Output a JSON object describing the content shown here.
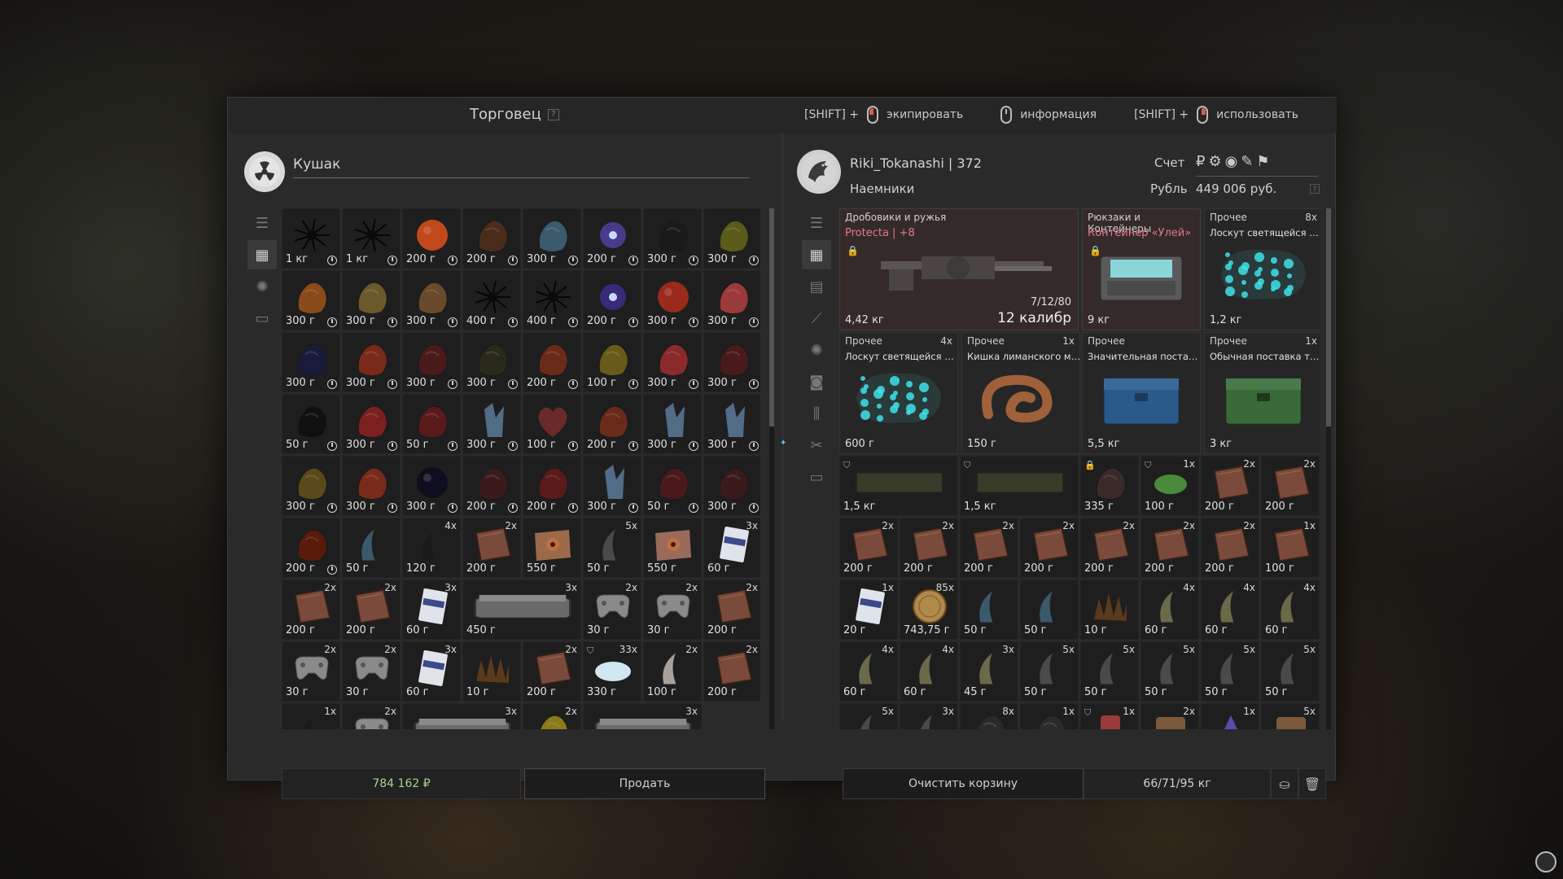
{
  "header": {
    "title": "Торговец",
    "help": "?",
    "hints": [
      {
        "prefix": "[SHIFT] +",
        "mouse": "left",
        "label": "экипировать"
      },
      {
        "prefix": "",
        "mouse": "middle",
        "label": "информация"
      },
      {
        "prefix": "[SHIFT] +",
        "mouse": "right",
        "label": "использовать"
      }
    ]
  },
  "trader": {
    "name": "Кушак",
    "icon": "radiation-icon",
    "money": "784 162 ₽",
    "sell_label": "Продать",
    "items": [
      {
        "price": "1 кг",
        "icon": "spiky-black-artifact",
        "clock": true,
        "color": "#101010"
      },
      {
        "price": "1 кг",
        "icon": "spiky-black-artifact",
        "clock": true,
        "color": "#121212"
      },
      {
        "price": "200 г",
        "icon": "fire-orb",
        "clock": true,
        "color": "#c0481a"
      },
      {
        "price": "200 г",
        "icon": "brown-crystal",
        "clock": true,
        "color": "#4b2b1a"
      },
      {
        "price": "300 г",
        "icon": "blue-mist",
        "clock": true,
        "color": "#3b5a6b"
      },
      {
        "price": "200 г",
        "icon": "blue-spark",
        "clock": true,
        "color": "#4a3a8a"
      },
      {
        "price": "300 г",
        "icon": "black-crystal",
        "clock": true,
        "color": "#1a1a1a"
      },
      {
        "price": "300 г",
        "icon": "yellow-black-rock",
        "clock": true,
        "color": "#5a5a1a"
      },
      {
        "price": "300 г",
        "icon": "amber-rock",
        "clock": true,
        "color": "#8a4a1a"
      },
      {
        "price": "300 г",
        "icon": "green-shard",
        "clock": true,
        "color": "#6a5a2a"
      },
      {
        "price": "300 г",
        "icon": "green-shard",
        "clock": true,
        "color": "#6a4a2a"
      },
      {
        "price": "400 г",
        "icon": "black-spike",
        "clock": true,
        "color": "#0e0e0e"
      },
      {
        "price": "400 г",
        "icon": "black-spike",
        "clock": true,
        "color": "#0e0e0e"
      },
      {
        "price": "200 г",
        "icon": "blue-spark",
        "clock": true,
        "color": "#3a2a7a"
      },
      {
        "price": "300 г",
        "icon": "red-orb",
        "clock": true,
        "color": "#9a2a1a"
      },
      {
        "price": "300 г",
        "icon": "red-crystal",
        "clock": true,
        "color": "#9a3a3a"
      },
      {
        "price": "300 г",
        "icon": "dark-rock",
        "clock": true,
        "color": "#1a1a3a"
      },
      {
        "price": "300 г",
        "icon": "red-rock",
        "clock": true,
        "color": "#7a2a1a"
      },
      {
        "price": "300 г",
        "icon": "dark-red-rock",
        "clock": true,
        "color": "#4a1a1a"
      },
      {
        "price": "300 г",
        "icon": "dark-green-shard",
        "clock": true,
        "color": "#2a2a1a"
      },
      {
        "price": "200 г",
        "icon": "lava-rock",
        "clock": true,
        "color": "#6a2a1a"
      },
      {
        "price": "100 г",
        "icon": "yellow-shard",
        "clock": true,
        "color": "#6a5a1a"
      },
      {
        "price": "300 г",
        "icon": "red-rock",
        "clock": true,
        "color": "#8a2a2a"
      },
      {
        "price": "300 г",
        "icon": "dark-red-rock",
        "clock": true,
        "color": "#4a1a1a"
      },
      {
        "price": "50 г",
        "icon": "black-leaf",
        "clock": true,
        "color": "#101010"
      },
      {
        "price": "300 г",
        "icon": "red-rock",
        "clock": true,
        "color": "#7a2020"
      },
      {
        "price": "50 г",
        "icon": "red-leaf",
        "clock": true,
        "color": "#5a1a1a"
      },
      {
        "price": "300 г",
        "icon": "blue-crystal",
        "clock": true,
        "color": "#5a7a9a"
      },
      {
        "price": "100 г",
        "icon": "heart",
        "clock": true,
        "color": "#6a2a2a"
      },
      {
        "price": "200 г",
        "icon": "lava-rock",
        "clock": true,
        "color": "#6a2a1a"
      },
      {
        "price": "300 г",
        "icon": "blue-crystal",
        "clock": true,
        "color": "#5a7a9a"
      },
      {
        "price": "300 г",
        "icon": "blue-crystal",
        "clock": true,
        "color": "#5a7a9a"
      },
      {
        "price": "300 г",
        "icon": "green-shard",
        "clock": true,
        "color": "#5a4a1a"
      },
      {
        "price": "300 г",
        "icon": "red-rock",
        "clock": true,
        "color": "#7a2a1a"
      },
      {
        "price": "300 г",
        "icon": "black-orb",
        "clock": true,
        "color": "#0e0e1e"
      },
      {
        "price": "200 г",
        "icon": "brown-rock",
        "clock": true,
        "color": "#3a1a1a"
      },
      {
        "price": "200 г",
        "icon": "lava-rock",
        "clock": true,
        "color": "#5a1a1a"
      },
      {
        "price": "300 г",
        "icon": "blue-crystal",
        "clock": true,
        "color": "#5a7a9a"
      },
      {
        "price": "50 г",
        "icon": "red-leaf",
        "clock": true,
        "color": "#4a1a1a"
      },
      {
        "price": "300 г",
        "icon": "dark-red-rock",
        "clock": true,
        "color": "#3a1a1a"
      },
      {
        "price": "200 г",
        "icon": "lava-rock",
        "clock": true,
        "color": "#5a1a0a"
      },
      {
        "price": "50 г",
        "icon": "blue-claw",
        "clock": false,
        "color": "#3a5a6a"
      },
      {
        "price": "120 г",
        "icon": "black-horn",
        "clock": false,
        "qty": "4x",
        "color": "#1a1a1a"
      },
      {
        "price": "200 г",
        "icon": "leather-piece",
        "clock": false,
        "qty": "2x",
        "color": "#7a4a3a"
      },
      {
        "price": "550 г",
        "icon": "eye-piece",
        "clock": false,
        "color": "#9a6a4a"
      },
      {
        "price": "50 г",
        "icon": "grey-horn",
        "clock": false,
        "qty": "5x",
        "color": "#4a4a4a"
      },
      {
        "price": "550 г",
        "icon": "eye-piece",
        "clock": false,
        "color": "#9a6a5a"
      },
      {
        "price": "60 г",
        "icon": "book",
        "clock": false,
        "qty": "3x",
        "color": "#7a8aaa"
      },
      {
        "price": "200 г",
        "icon": "leather-piece",
        "clock": false,
        "qty": "2x",
        "color": "#7a4a3a"
      },
      {
        "price": "200 г",
        "icon": "leather-piece",
        "clock": false,
        "qty": "2x",
        "color": "#7a4a3a"
      },
      {
        "price": "60 г",
        "icon": "book",
        "clock": false,
        "qty": "3x",
        "color": "#7a8aaa"
      },
      {
        "price": "450 г",
        "icon": "container",
        "clock": false,
        "qty": "3x",
        "wide": true,
        "color": "#6a6a6a"
      },
      {
        "price": "30 г",
        "icon": "gamepad",
        "clock": false,
        "qty": "2x",
        "color": "#8a8a8a"
      },
      {
        "price": "30 г",
        "icon": "gamepad",
        "clock": false,
        "qty": "2x",
        "color": "#8a8a8a"
      },
      {
        "price": "200 г",
        "icon": "leather-piece",
        "clock": false,
        "qty": "2x",
        "color": "#7a4a3a"
      },
      {
        "price": "30 г",
        "icon": "gamepad",
        "clock": false,
        "qty": "2x",
        "color": "#8a8a8a"
      },
      {
        "price": "30 г",
        "icon": "gamepad",
        "clock": false,
        "qty": "2x",
        "color": "#8a8a8a"
      },
      {
        "price": "60 г",
        "icon": "book",
        "clock": false,
        "qty": "3x",
        "color": "#7a8aaa"
      },
      {
        "price": "10 г",
        "icon": "spikes",
        "clock": false,
        "color": "#5a3a1a"
      },
      {
        "price": "200 г",
        "icon": "leather-piece",
        "clock": false,
        "qty": "2x",
        "color": "#7a4a3a"
      },
      {
        "price": "330 г",
        "icon": "white-fluff",
        "clock": false,
        "qty": "33x",
        "shield": true,
        "color": "#cfe8ef"
      },
      {
        "price": "100 г",
        "icon": "white-horn",
        "clock": false,
        "qty": "2x",
        "color": "#aaa09a"
      },
      {
        "price": "200 г",
        "icon": "leather-piece",
        "clock": false,
        "qty": "2x",
        "color": "#7a4a3a"
      },
      {
        "price": "",
        "icon": "black-horn",
        "clock": false,
        "qty": "1x",
        "color": "#1a1a1a"
      },
      {
        "price": "",
        "icon": "gamepad",
        "clock": false,
        "qty": "2x",
        "color": "#8a8a8a"
      },
      {
        "price": "",
        "icon": "container",
        "clock": false,
        "qty": "3x",
        "wide": true,
        "color": "#6a6a6a"
      },
      {
        "price": "",
        "icon": "yellow-shard",
        "clock": false,
        "qty": "2x",
        "color": "#8a7a1a"
      },
      {
        "price": "",
        "icon": "container",
        "clock": false,
        "qty": "3x",
        "wide": true,
        "color": "#6a6a6a"
      }
    ]
  },
  "player": {
    "name": "Riki_Tokanashi | 372",
    "faction": "Наемники",
    "account_label": "Счет",
    "currency_label": "Рубль",
    "currency_value": "449 006 руб.",
    "currency_icons": [
      "₽",
      "⚙",
      "◉",
      "✎",
      "⚑"
    ],
    "clear_label": "Очистить корзину",
    "weight": "66/71/95 кг",
    "big_items": [
      {
        "category": "Дробовики и ружья",
        "name": "Protecta | +8",
        "desc": "",
        "weight": "4,42 кг",
        "ammo": "7/12/80",
        "caliber": "12 калибр",
        "kind": "shotgun",
        "qty": ""
      },
      {
        "category": "Рюкзаки и Контейнеры",
        "name": "Контейнер «Улей»",
        "desc": "",
        "weight": "9 кг",
        "kind": "hive-container",
        "qty": ""
      },
      {
        "category": "Прочее",
        "name": "",
        "desc": "Лоскут светящейся кож...",
        "weight": "1,2 кг",
        "kind": "glowing-skin",
        "qty": "8x"
      },
      {
        "category": "Прочее",
        "name": "",
        "desc": "Лоскут светящейся кож...",
        "weight": "600 г",
        "kind": "glowing-skin",
        "qty": "4x"
      },
      {
        "category": "Прочее",
        "name": "",
        "desc": "Кишка лиманского мут...",
        "weight": "150 г",
        "kind": "gut",
        "qty": "1x"
      },
      {
        "category": "Прочее",
        "name": "",
        "desc": "Значительная поставка...",
        "weight": "5,5 кг",
        "kind": "blue-crate",
        "qty": ""
      },
      {
        "category": "Прочее",
        "name": "",
        "desc": "Обычная поставка торг...",
        "weight": "3 кг",
        "kind": "green-crate",
        "qty": "1x"
      }
    ],
    "small_items": [
      {
        "price": "1,5 кг",
        "icon": "armor-box",
        "qty": "",
        "wide": true,
        "shield": true,
        "color": "#3a3a2a"
      },
      {
        "price": "1,5 кг",
        "icon": "armor-box",
        "qty": "",
        "wide": true,
        "shield": true,
        "color": "#3a3a2a"
      },
      {
        "price": "335 г",
        "icon": "dark-lump",
        "qty": "",
        "lock": true,
        "color": "#3a2a2a"
      },
      {
        "price": "100 г",
        "icon": "green-jar",
        "qty": "1x",
        "shield": true,
        "color": "#4a8a3a"
      },
      {
        "price": "200 г",
        "icon": "leather-piece",
        "qty": "2x",
        "color": "#7a4a3a"
      },
      {
        "price": "200 г",
        "icon": "leather-piece",
        "qty": "2x",
        "color": "#7a4a3a"
      },
      {
        "price": "200 г",
        "icon": "leather-piece",
        "qty": "2x",
        "color": "#7a4a3a"
      },
      {
        "price": "200 г",
        "icon": "leather-piece",
        "qty": "2x",
        "color": "#7a4a3a"
      },
      {
        "price": "200 г",
        "icon": "leather-piece",
        "qty": "2x",
        "color": "#7a4a3a"
      },
      {
        "price": "200 г",
        "icon": "leather-piece",
        "qty": "2x",
        "color": "#7a4a3a"
      },
      {
        "price": "200 г",
        "icon": "leather-piece",
        "qty": "2x",
        "color": "#7a4a3a"
      },
      {
        "price": "200 г",
        "icon": "leather-piece",
        "qty": "2x",
        "color": "#7a4a3a"
      },
      {
        "price": "200 г",
        "icon": "leather-piece",
        "qty": "2x",
        "color": "#7a4a3a"
      },
      {
        "price": "100 г",
        "icon": "leather-piece",
        "qty": "1x",
        "color": "#7a4a3a"
      },
      {
        "price": "20 г",
        "icon": "book",
        "qty": "1x",
        "color": "#7a8aaa"
      },
      {
        "price": "743,75 г",
        "icon": "coin",
        "qty": "85x",
        "color": "#b08a4a"
      },
      {
        "price": "50 г",
        "icon": "blue-claw",
        "qty": "",
        "color": "#3a5a6a"
      },
      {
        "price": "50 г",
        "icon": "blue-claw",
        "qty": "",
        "color": "#3a5a6a"
      },
      {
        "price": "10 г",
        "icon": "spikes",
        "qty": "",
        "color": "#5a3a1a"
      },
      {
        "price": "60 г",
        "icon": "green-claw",
        "qty": "4x",
        "color": "#6a6a4a"
      },
      {
        "price": "60 г",
        "icon": "green-claw",
        "qty": "4x",
        "color": "#6a6a4a"
      },
      {
        "price": "60 г",
        "icon": "green-claw",
        "qty": "4x",
        "color": "#6a6a4a"
      },
      {
        "price": "60 г",
        "icon": "green-claw",
        "qty": "4x",
        "color": "#6a6a4a"
      },
      {
        "price": "60 г",
        "icon": "green-claw",
        "qty": "4x",
        "color": "#6a6a4a"
      },
      {
        "price": "45 г",
        "icon": "green-claw",
        "qty": "3x",
        "color": "#6a6a4a"
      },
      {
        "price": "50 г",
        "icon": "grey-horn",
        "qty": "5x",
        "color": "#4a4a4a"
      },
      {
        "price": "50 г",
        "icon": "grey-horn",
        "qty": "5x",
        "color": "#4a4a4a"
      },
      {
        "price": "50 г",
        "icon": "grey-horn",
        "qty": "5x",
        "color": "#4a4a4a"
      },
      {
        "price": "50 г",
        "icon": "grey-horn",
        "qty": "5x",
        "color": "#4a4a4a"
      },
      {
        "price": "50 г",
        "icon": "grey-horn",
        "qty": "5x",
        "color": "#4a4a4a"
      },
      {
        "price": "",
        "icon": "grey-horn",
        "qty": "5x",
        "color": "#4a4a4a"
      },
      {
        "price": "",
        "icon": "grey-horn",
        "qty": "3x",
        "color": "#4a4a4a"
      },
      {
        "price": "",
        "icon": "dark-lump",
        "qty": "8x",
        "color": "#2a2a2a"
      },
      {
        "price": "",
        "icon": "dark-lump",
        "qty": "1x",
        "color": "#2a2a2a"
      },
      {
        "price": "",
        "icon": "red-can",
        "qty": "1x",
        "shield": true,
        "color": "#9a3a3a"
      },
      {
        "price": "",
        "icon": "badge",
        "qty": "2x",
        "color": "#7a5a3a"
      },
      {
        "price": "",
        "icon": "purple-item",
        "qty": "1x",
        "color": "#5a4aaa"
      },
      {
        "price": "",
        "icon": "badge",
        "qty": "5x",
        "color": "#7a5a3a"
      }
    ]
  },
  "colors": {
    "accent_pink": "#e07a8a",
    "money_green": "#a7d38f",
    "panel_bg": "#2a2a2a",
    "cell_bg": "#1e1e1e"
  }
}
